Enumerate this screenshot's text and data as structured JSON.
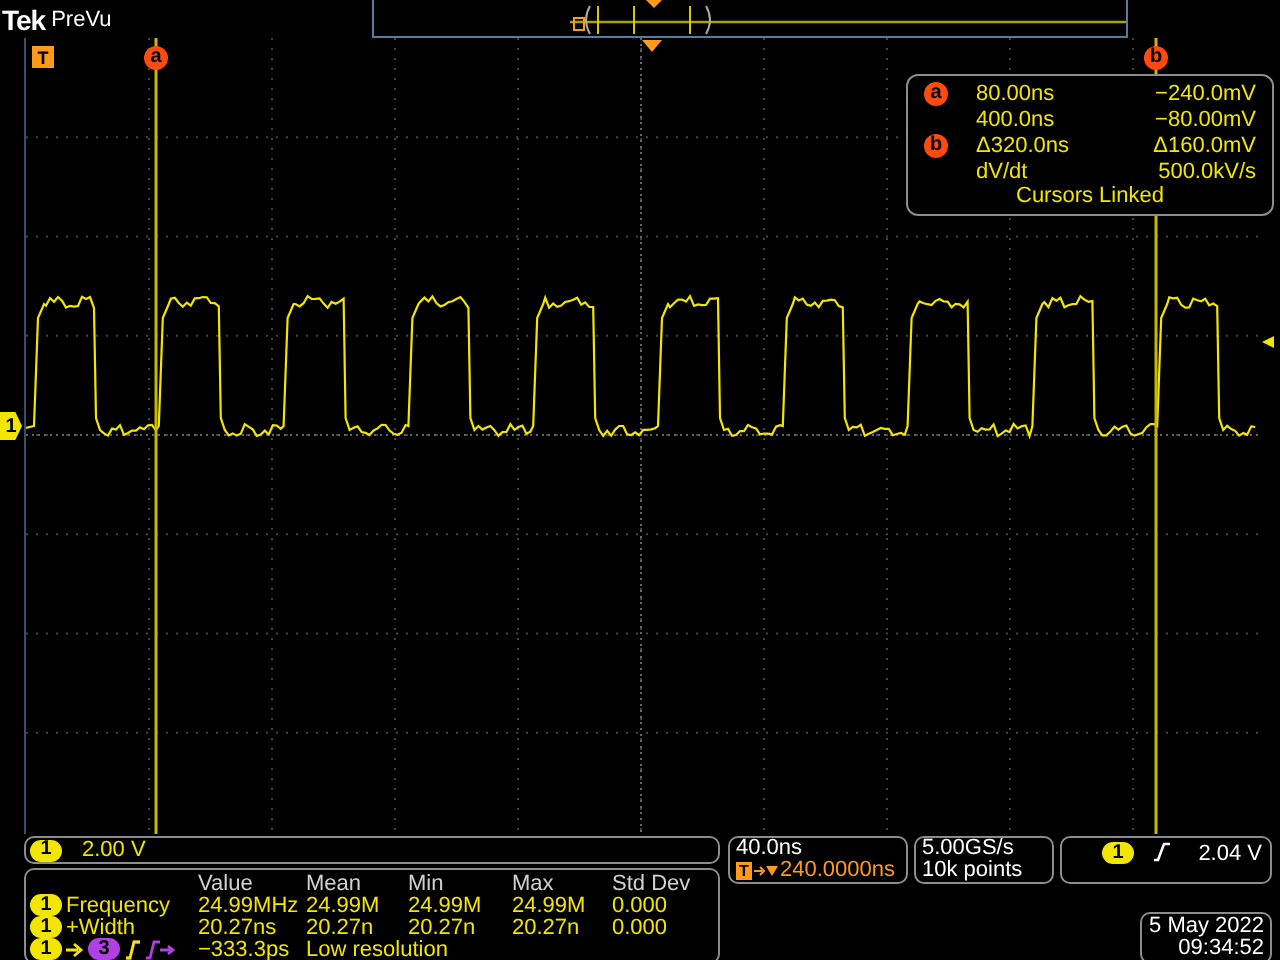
{
  "brand": {
    "logo": "Tek",
    "mode": "PreVu"
  },
  "graticule": {
    "trigger_position_label": "T",
    "cursors": [
      {
        "label": "a"
      },
      {
        "label": "b"
      }
    ],
    "channel_marker": "1"
  },
  "cursor_readout": {
    "rows": [
      {
        "badge": "a",
        "time": "80.00ns",
        "value": "−240.0mV"
      },
      {
        "time": "400.0ns",
        "value": "−80.00mV"
      },
      {
        "badge": "b",
        "time": "Δ320.0ns",
        "value": "Δ160.0mV"
      },
      {
        "time": "dV/dt",
        "value": "500.0kV/s"
      }
    ],
    "footer": "Cursors Linked"
  },
  "vertical": {
    "channel": "1",
    "scale": "2.00 V"
  },
  "measurements": {
    "columns": [
      "Value",
      "Mean",
      "Min",
      "Max",
      "Std Dev"
    ],
    "rows": [
      {
        "kind": "stat",
        "channel": "1",
        "name": "Frequency",
        "cells": [
          "24.99MHz",
          "24.99M",
          "24.99M",
          "24.99M",
          "0.000"
        ]
      },
      {
        "kind": "stat",
        "channel": "1",
        "name": "+Width",
        "cells": [
          "20.27ns",
          "20.27n",
          "20.27n",
          "20.27n",
          "0.000"
        ]
      },
      {
        "kind": "delay",
        "channel": "1",
        "target": "3",
        "value": "−333.3ps",
        "note": "Low resolution"
      }
    ]
  },
  "horizontal": {
    "scale": "40.0ns",
    "trigger_label": "T",
    "delay": "240.0000ns"
  },
  "acquisition": {
    "rate": "5.00GS/s",
    "length": "10k points"
  },
  "trigger": {
    "channel": "1",
    "level": "2.04 V"
  },
  "datetime": {
    "date": "5 May 2022",
    "time": "09:34:52"
  }
}
